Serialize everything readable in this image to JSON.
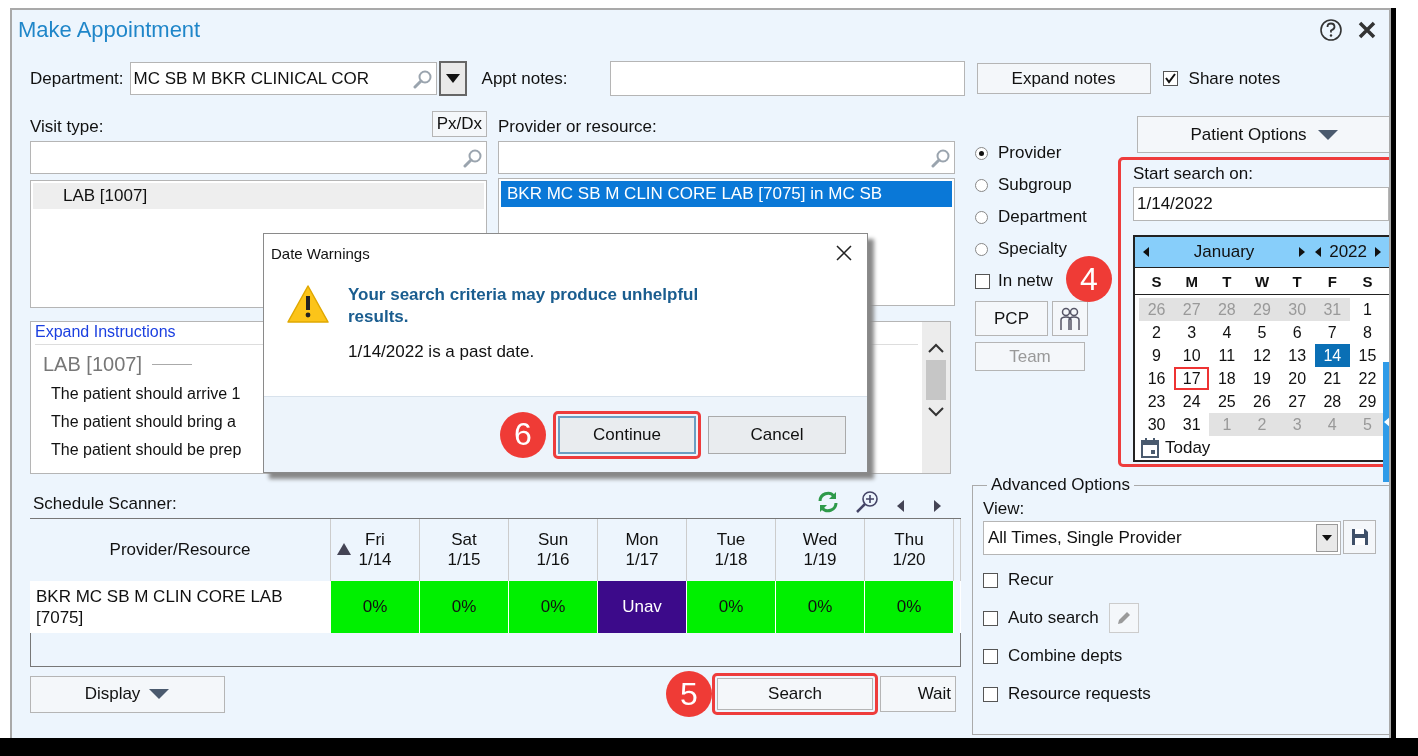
{
  "window": {
    "title": "Make Appointment"
  },
  "department": {
    "label": "Department:",
    "value": "MC SB M BKR CLINICAL COR"
  },
  "appt_notes": {
    "label": "Appt notes:"
  },
  "expand_notes_button": "Expand notes",
  "share_notes": {
    "label": "Share notes",
    "checked": true
  },
  "visit_type": {
    "label": "Visit type:",
    "px_dx_button": "Px/Dx",
    "items": [
      {
        "label": "LAB [1007]",
        "selected": true
      }
    ]
  },
  "provider": {
    "label": "Provider or resource:",
    "items": [
      {
        "label": "BKR MC SB M CLIN CORE LAB [7075] in MC SB",
        "selected": true
      }
    ]
  },
  "search_by": [
    {
      "label": "Provider",
      "selected": true
    },
    {
      "label": "Subgroup",
      "selected": false
    },
    {
      "label": "Department",
      "selected": false
    },
    {
      "label": "Specialty",
      "selected": false
    }
  ],
  "in_network": {
    "label": "In netw",
    "checked": false
  },
  "pcp_button": "PCP",
  "team_button": {
    "label": "Team",
    "disabled": true
  },
  "patient_options_button": "Patient Options",
  "start_search": {
    "label": "Start search on:",
    "value": "1/14/2022",
    "highlighted": true
  },
  "calendar": {
    "month": "January",
    "year": "2022",
    "weekdays": [
      "S",
      "M",
      "T",
      "W",
      "T",
      "F",
      "S"
    ],
    "today_button": "Today",
    "days": [
      {
        "label": "26",
        "other_month": true,
        "selected": false,
        "today": false
      },
      {
        "label": "27",
        "other_month": true,
        "selected": false,
        "today": false
      },
      {
        "label": "28",
        "other_month": true,
        "selected": false,
        "today": false
      },
      {
        "label": "29",
        "other_month": true,
        "selected": false,
        "today": false
      },
      {
        "label": "30",
        "other_month": true,
        "selected": false,
        "today": false
      },
      {
        "label": "31",
        "other_month": true,
        "selected": false,
        "today": false
      },
      {
        "label": "1",
        "other_month": false,
        "selected": false,
        "today": false
      },
      {
        "label": "2",
        "other_month": false,
        "selected": false,
        "today": false
      },
      {
        "label": "3",
        "other_month": false,
        "selected": false,
        "today": false
      },
      {
        "label": "4",
        "other_month": false,
        "selected": false,
        "today": false
      },
      {
        "label": "5",
        "other_month": false,
        "selected": false,
        "today": false
      },
      {
        "label": "6",
        "other_month": false,
        "selected": false,
        "today": false
      },
      {
        "label": "7",
        "other_month": false,
        "selected": false,
        "today": false
      },
      {
        "label": "8",
        "other_month": false,
        "selected": false,
        "today": false
      },
      {
        "label": "9",
        "other_month": false,
        "selected": false,
        "today": false
      },
      {
        "label": "10",
        "other_month": false,
        "selected": false,
        "today": false
      },
      {
        "label": "11",
        "other_month": false,
        "selected": false,
        "today": false
      },
      {
        "label": "12",
        "other_month": false,
        "selected": false,
        "today": false
      },
      {
        "label": "13",
        "other_month": false,
        "selected": false,
        "today": false
      },
      {
        "label": "14",
        "other_month": false,
        "selected": true,
        "today": false
      },
      {
        "label": "15",
        "other_month": false,
        "selected": false,
        "today": false
      },
      {
        "label": "16",
        "other_month": false,
        "selected": false,
        "today": false
      },
      {
        "label": "17",
        "other_month": false,
        "selected": false,
        "today": true
      },
      {
        "label": "18",
        "other_month": false,
        "selected": false,
        "today": false
      },
      {
        "label": "19",
        "other_month": false,
        "selected": false,
        "today": false
      },
      {
        "label": "20",
        "other_month": false,
        "selected": false,
        "today": false
      },
      {
        "label": "21",
        "other_month": false,
        "selected": false,
        "today": false
      },
      {
        "label": "22",
        "other_month": false,
        "selected": false,
        "today": false
      },
      {
        "label": "23",
        "other_month": false,
        "selected": false,
        "today": false
      },
      {
        "label": "24",
        "other_month": false,
        "selected": false,
        "today": false
      },
      {
        "label": "25",
        "other_month": false,
        "selected": false,
        "today": false
      },
      {
        "label": "26",
        "other_month": false,
        "selected": false,
        "today": false
      },
      {
        "label": "27",
        "other_month": false,
        "selected": false,
        "today": false
      },
      {
        "label": "28",
        "other_month": false,
        "selected": false,
        "today": false
      },
      {
        "label": "29",
        "other_month": false,
        "selected": false,
        "today": false
      },
      {
        "label": "30",
        "other_month": false,
        "selected": false,
        "today": false
      },
      {
        "label": "31",
        "other_month": false,
        "selected": false,
        "today": false
      },
      {
        "label": "1",
        "other_month": true,
        "selected": false,
        "today": false
      },
      {
        "label": "2",
        "other_month": true,
        "selected": false,
        "today": false
      },
      {
        "label": "3",
        "other_month": true,
        "selected": false,
        "today": false
      },
      {
        "label": "4",
        "other_month": true,
        "selected": false,
        "today": false
      },
      {
        "label": "5",
        "other_month": true,
        "selected": false,
        "today": false
      }
    ]
  },
  "instructions": {
    "expand_link": "Expand Instructions",
    "heading": "LAB [1007]",
    "lines": [
      "The patient should arrive 1",
      "The patient should bring a",
      "The patient should be prep"
    ]
  },
  "schedule_scanner": {
    "label": "Schedule Scanner:",
    "columns": [
      {
        "label": "Provider/Resource"
      },
      {
        "day": "Fri",
        "date": "1/14",
        "sorted": true
      },
      {
        "day": "Sat",
        "date": "1/15",
        "sorted": false
      },
      {
        "day": "Sun",
        "date": "1/16",
        "sorted": false
      },
      {
        "day": "Mon",
        "date": "1/17",
        "sorted": false
      },
      {
        "day": "Tue",
        "date": "1/18",
        "sorted": false
      },
      {
        "day": "Wed",
        "date": "1/19",
        "sorted": false
      },
      {
        "day": "Thu",
        "date": "1/20",
        "sorted": false
      }
    ],
    "rows": [
      {
        "cells": [
          {
            "text": "BKR MC SB M CLIN CORE LAB [7075]",
            "kind": "provider"
          },
          {
            "text": "0%",
            "kind": "open"
          },
          {
            "text": "0%",
            "kind": "open"
          },
          {
            "text": "0%",
            "kind": "open"
          },
          {
            "text": "Unav",
            "kind": "unavailable"
          },
          {
            "text": "0%",
            "kind": "open"
          },
          {
            "text": "0%",
            "kind": "open"
          },
          {
            "text": "0%",
            "kind": "open"
          }
        ]
      }
    ]
  },
  "display_button": "Display",
  "search_button": {
    "label": "Search",
    "highlighted": true
  },
  "wait_button": "Wait",
  "advanced_options": {
    "title": "Advanced Options",
    "view_label": "View:",
    "view_value": "All Times, Single Provider",
    "options": [
      {
        "label": "Recur",
        "checked": false,
        "kind": "plain"
      },
      {
        "label": "Auto search",
        "checked": false,
        "kind": "editable"
      },
      {
        "label": "Combine depts",
        "checked": false,
        "kind": "plain"
      },
      {
        "label": "Resource requests",
        "checked": false,
        "kind": "plain"
      }
    ]
  },
  "dialog": {
    "title": "Date Warnings",
    "heading": "Your search criteria may produce unhelpful results.",
    "message": "1/14/2022 is a past date.",
    "buttons": [
      {
        "label": "Continue",
        "default": true,
        "highlighted": true
      },
      {
        "label": "Cancel",
        "default": false,
        "highlighted": false
      }
    ]
  },
  "callouts": [
    "4",
    "5",
    "6"
  ]
}
